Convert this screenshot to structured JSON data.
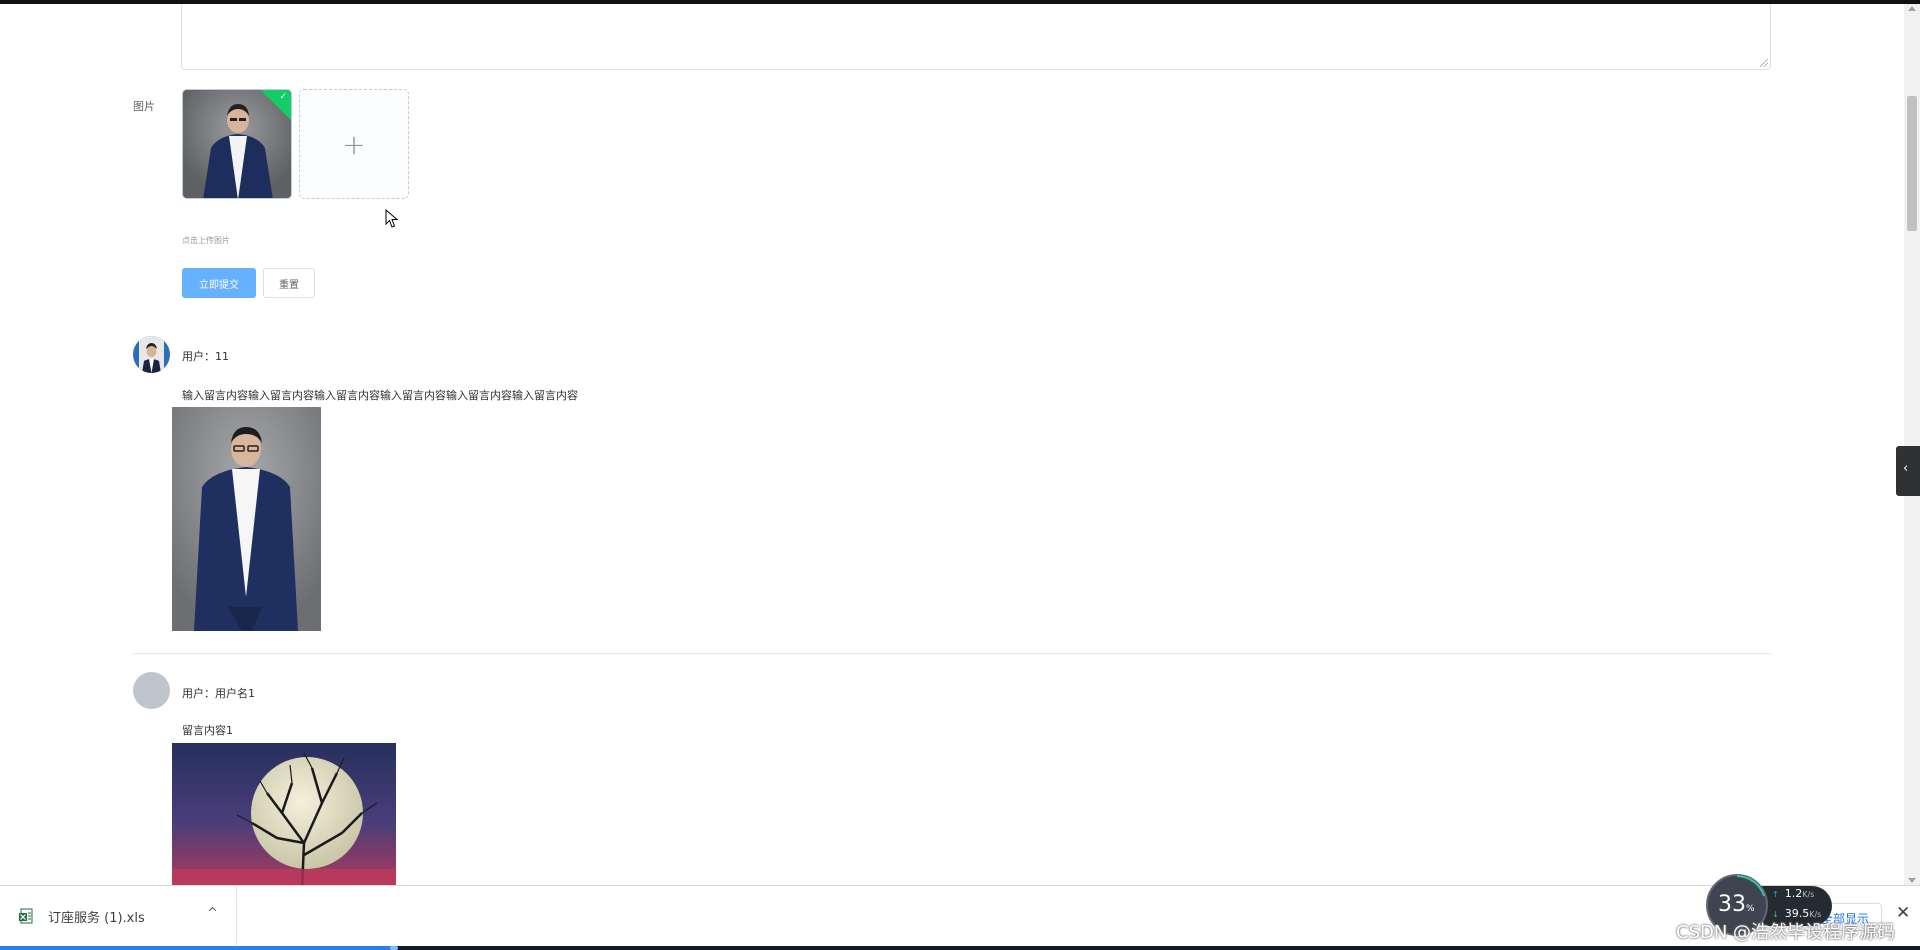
{
  "form": {
    "image_label": "图片",
    "upload_plus": "+",
    "success_check": "✓",
    "upload_tip": "点击上传图片",
    "submit_label": "立即提交",
    "reset_label": "重置"
  },
  "comments": [
    {
      "username": "用户：11",
      "content": "输入留言内容输入留言内容输入留言内容输入留言内容输入留言内容输入留言内容"
    },
    {
      "username": "用户：用户名1",
      "content": "留言内容1"
    }
  ],
  "side_tab": {
    "icon": "‹"
  },
  "downloads": {
    "file_name": "订座服务 (1).xls",
    "caret": "^",
    "show_all": "全部显示",
    "close": "✕"
  },
  "network": {
    "percent": "33",
    "percent_unit": "%",
    "upload_speed": "1.2",
    "download_speed": "39.5",
    "speed_unit": "K/s",
    "up_arrow": "↑",
    "down_arrow": "↓"
  },
  "watermark": "CSDN @浩然毕设程序源码",
  "colors": {
    "primary_light": "#66b1ff",
    "success": "#13ce66",
    "link": "#1a73e8"
  }
}
